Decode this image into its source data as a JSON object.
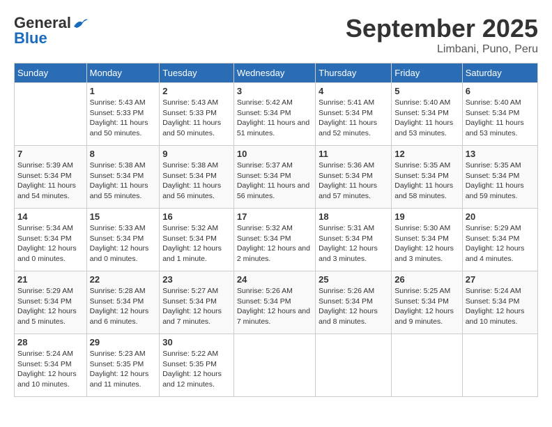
{
  "header": {
    "logo_general": "General",
    "logo_blue": "Blue",
    "title": "September 2025",
    "location": "Limbani, Puno, Peru"
  },
  "days_of_week": [
    "Sunday",
    "Monday",
    "Tuesday",
    "Wednesday",
    "Thursday",
    "Friday",
    "Saturday"
  ],
  "weeks": [
    [
      {
        "day": "",
        "sunrise": "",
        "sunset": "",
        "daylight": ""
      },
      {
        "day": "1",
        "sunrise": "Sunrise: 5:43 AM",
        "sunset": "Sunset: 5:33 PM",
        "daylight": "Daylight: 11 hours and 50 minutes."
      },
      {
        "day": "2",
        "sunrise": "Sunrise: 5:43 AM",
        "sunset": "Sunset: 5:33 PM",
        "daylight": "Daylight: 11 hours and 50 minutes."
      },
      {
        "day": "3",
        "sunrise": "Sunrise: 5:42 AM",
        "sunset": "Sunset: 5:34 PM",
        "daylight": "Daylight: 11 hours and 51 minutes."
      },
      {
        "day": "4",
        "sunrise": "Sunrise: 5:41 AM",
        "sunset": "Sunset: 5:34 PM",
        "daylight": "Daylight: 11 hours and 52 minutes."
      },
      {
        "day": "5",
        "sunrise": "Sunrise: 5:40 AM",
        "sunset": "Sunset: 5:34 PM",
        "daylight": "Daylight: 11 hours and 53 minutes."
      },
      {
        "day": "6",
        "sunrise": "Sunrise: 5:40 AM",
        "sunset": "Sunset: 5:34 PM",
        "daylight": "Daylight: 11 hours and 53 minutes."
      }
    ],
    [
      {
        "day": "7",
        "sunrise": "Sunrise: 5:39 AM",
        "sunset": "Sunset: 5:34 PM",
        "daylight": "Daylight: 11 hours and 54 minutes."
      },
      {
        "day": "8",
        "sunrise": "Sunrise: 5:38 AM",
        "sunset": "Sunset: 5:34 PM",
        "daylight": "Daylight: 11 hours and 55 minutes."
      },
      {
        "day": "9",
        "sunrise": "Sunrise: 5:38 AM",
        "sunset": "Sunset: 5:34 PM",
        "daylight": "Daylight: 11 hours and 56 minutes."
      },
      {
        "day": "10",
        "sunrise": "Sunrise: 5:37 AM",
        "sunset": "Sunset: 5:34 PM",
        "daylight": "Daylight: 11 hours and 56 minutes."
      },
      {
        "day": "11",
        "sunrise": "Sunrise: 5:36 AM",
        "sunset": "Sunset: 5:34 PM",
        "daylight": "Daylight: 11 hours and 57 minutes."
      },
      {
        "day": "12",
        "sunrise": "Sunrise: 5:35 AM",
        "sunset": "Sunset: 5:34 PM",
        "daylight": "Daylight: 11 hours and 58 minutes."
      },
      {
        "day": "13",
        "sunrise": "Sunrise: 5:35 AM",
        "sunset": "Sunset: 5:34 PM",
        "daylight": "Daylight: 11 hours and 59 minutes."
      }
    ],
    [
      {
        "day": "14",
        "sunrise": "Sunrise: 5:34 AM",
        "sunset": "Sunset: 5:34 PM",
        "daylight": "Daylight: 12 hours and 0 minutes."
      },
      {
        "day": "15",
        "sunrise": "Sunrise: 5:33 AM",
        "sunset": "Sunset: 5:34 PM",
        "daylight": "Daylight: 12 hours and 0 minutes."
      },
      {
        "day": "16",
        "sunrise": "Sunrise: 5:32 AM",
        "sunset": "Sunset: 5:34 PM",
        "daylight": "Daylight: 12 hours and 1 minute."
      },
      {
        "day": "17",
        "sunrise": "Sunrise: 5:32 AM",
        "sunset": "Sunset: 5:34 PM",
        "daylight": "Daylight: 12 hours and 2 minutes."
      },
      {
        "day": "18",
        "sunrise": "Sunrise: 5:31 AM",
        "sunset": "Sunset: 5:34 PM",
        "daylight": "Daylight: 12 hours and 3 minutes."
      },
      {
        "day": "19",
        "sunrise": "Sunrise: 5:30 AM",
        "sunset": "Sunset: 5:34 PM",
        "daylight": "Daylight: 12 hours and 3 minutes."
      },
      {
        "day": "20",
        "sunrise": "Sunrise: 5:29 AM",
        "sunset": "Sunset: 5:34 PM",
        "daylight": "Daylight: 12 hours and 4 minutes."
      }
    ],
    [
      {
        "day": "21",
        "sunrise": "Sunrise: 5:29 AM",
        "sunset": "Sunset: 5:34 PM",
        "daylight": "Daylight: 12 hours and 5 minutes."
      },
      {
        "day": "22",
        "sunrise": "Sunrise: 5:28 AM",
        "sunset": "Sunset: 5:34 PM",
        "daylight": "Daylight: 12 hours and 6 minutes."
      },
      {
        "day": "23",
        "sunrise": "Sunrise: 5:27 AM",
        "sunset": "Sunset: 5:34 PM",
        "daylight": "Daylight: 12 hours and 7 minutes."
      },
      {
        "day": "24",
        "sunrise": "Sunrise: 5:26 AM",
        "sunset": "Sunset: 5:34 PM",
        "daylight": "Daylight: 12 hours and 7 minutes."
      },
      {
        "day": "25",
        "sunrise": "Sunrise: 5:26 AM",
        "sunset": "Sunset: 5:34 PM",
        "daylight": "Daylight: 12 hours and 8 minutes."
      },
      {
        "day": "26",
        "sunrise": "Sunrise: 5:25 AM",
        "sunset": "Sunset: 5:34 PM",
        "daylight": "Daylight: 12 hours and 9 minutes."
      },
      {
        "day": "27",
        "sunrise": "Sunrise: 5:24 AM",
        "sunset": "Sunset: 5:34 PM",
        "daylight": "Daylight: 12 hours and 10 minutes."
      }
    ],
    [
      {
        "day": "28",
        "sunrise": "Sunrise: 5:24 AM",
        "sunset": "Sunset: 5:34 PM",
        "daylight": "Daylight: 12 hours and 10 minutes."
      },
      {
        "day": "29",
        "sunrise": "Sunrise: 5:23 AM",
        "sunset": "Sunset: 5:35 PM",
        "daylight": "Daylight: 12 hours and 11 minutes."
      },
      {
        "day": "30",
        "sunrise": "Sunrise: 5:22 AM",
        "sunset": "Sunset: 5:35 PM",
        "daylight": "Daylight: 12 hours and 12 minutes."
      },
      {
        "day": "",
        "sunrise": "",
        "sunset": "",
        "daylight": ""
      },
      {
        "day": "",
        "sunrise": "",
        "sunset": "",
        "daylight": ""
      },
      {
        "day": "",
        "sunrise": "",
        "sunset": "",
        "daylight": ""
      },
      {
        "day": "",
        "sunrise": "",
        "sunset": "",
        "daylight": ""
      }
    ]
  ]
}
